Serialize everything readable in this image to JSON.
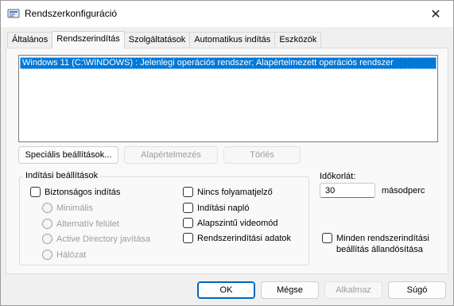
{
  "window": {
    "title": "Rendszerkonfiguráció",
    "app_icon": "msconfig-icon",
    "close_glyph": "✕"
  },
  "tabs": [
    {
      "label": "Általános",
      "active": false
    },
    {
      "label": "Rendszerindítás",
      "active": true
    },
    {
      "label": "Szolgáltatások",
      "active": false
    },
    {
      "label": "Automatikus indítás",
      "active": false
    },
    {
      "label": "Eszközök",
      "active": false
    }
  ],
  "os_list": {
    "items": [
      "Windows 11 (C:\\WINDOWS) : Jelenlegi operációs rendszer; Alapértelmezett operációs rendszer"
    ],
    "selected_index": 0
  },
  "list_buttons": {
    "advanced": "Speciális beállítások...",
    "set_default": "Alapértelmezés",
    "delete": "Törlés"
  },
  "boot_options": {
    "legend": "Indítási beállítások",
    "safe_boot": "Biztonságos indítás",
    "minimal": "Minimális",
    "alternate_shell": "Alternatív felület",
    "ad_repair": "Active Directory javítása",
    "network": "Hálózat",
    "no_gui_boot": "Nincs folyamatjelző",
    "boot_log": "Indítási napló",
    "base_video": "Alapszintű videomód",
    "os_boot_info": "Rendszerindítási adatok"
  },
  "timeout": {
    "label": "Időkorlát:",
    "value": "30",
    "unit": "másodperc"
  },
  "make_permanent": {
    "line1": "Minden rendszerindítási",
    "line2": "beállítás állandósítása"
  },
  "dialog_buttons": {
    "ok": "OK",
    "cancel": "Mégse",
    "apply": "Alkalmaz",
    "help": "Súgó"
  },
  "colors": {
    "selection": "#0078d7",
    "default_button_border": "#0067c0",
    "disabled_text": "#9d9d9d"
  }
}
